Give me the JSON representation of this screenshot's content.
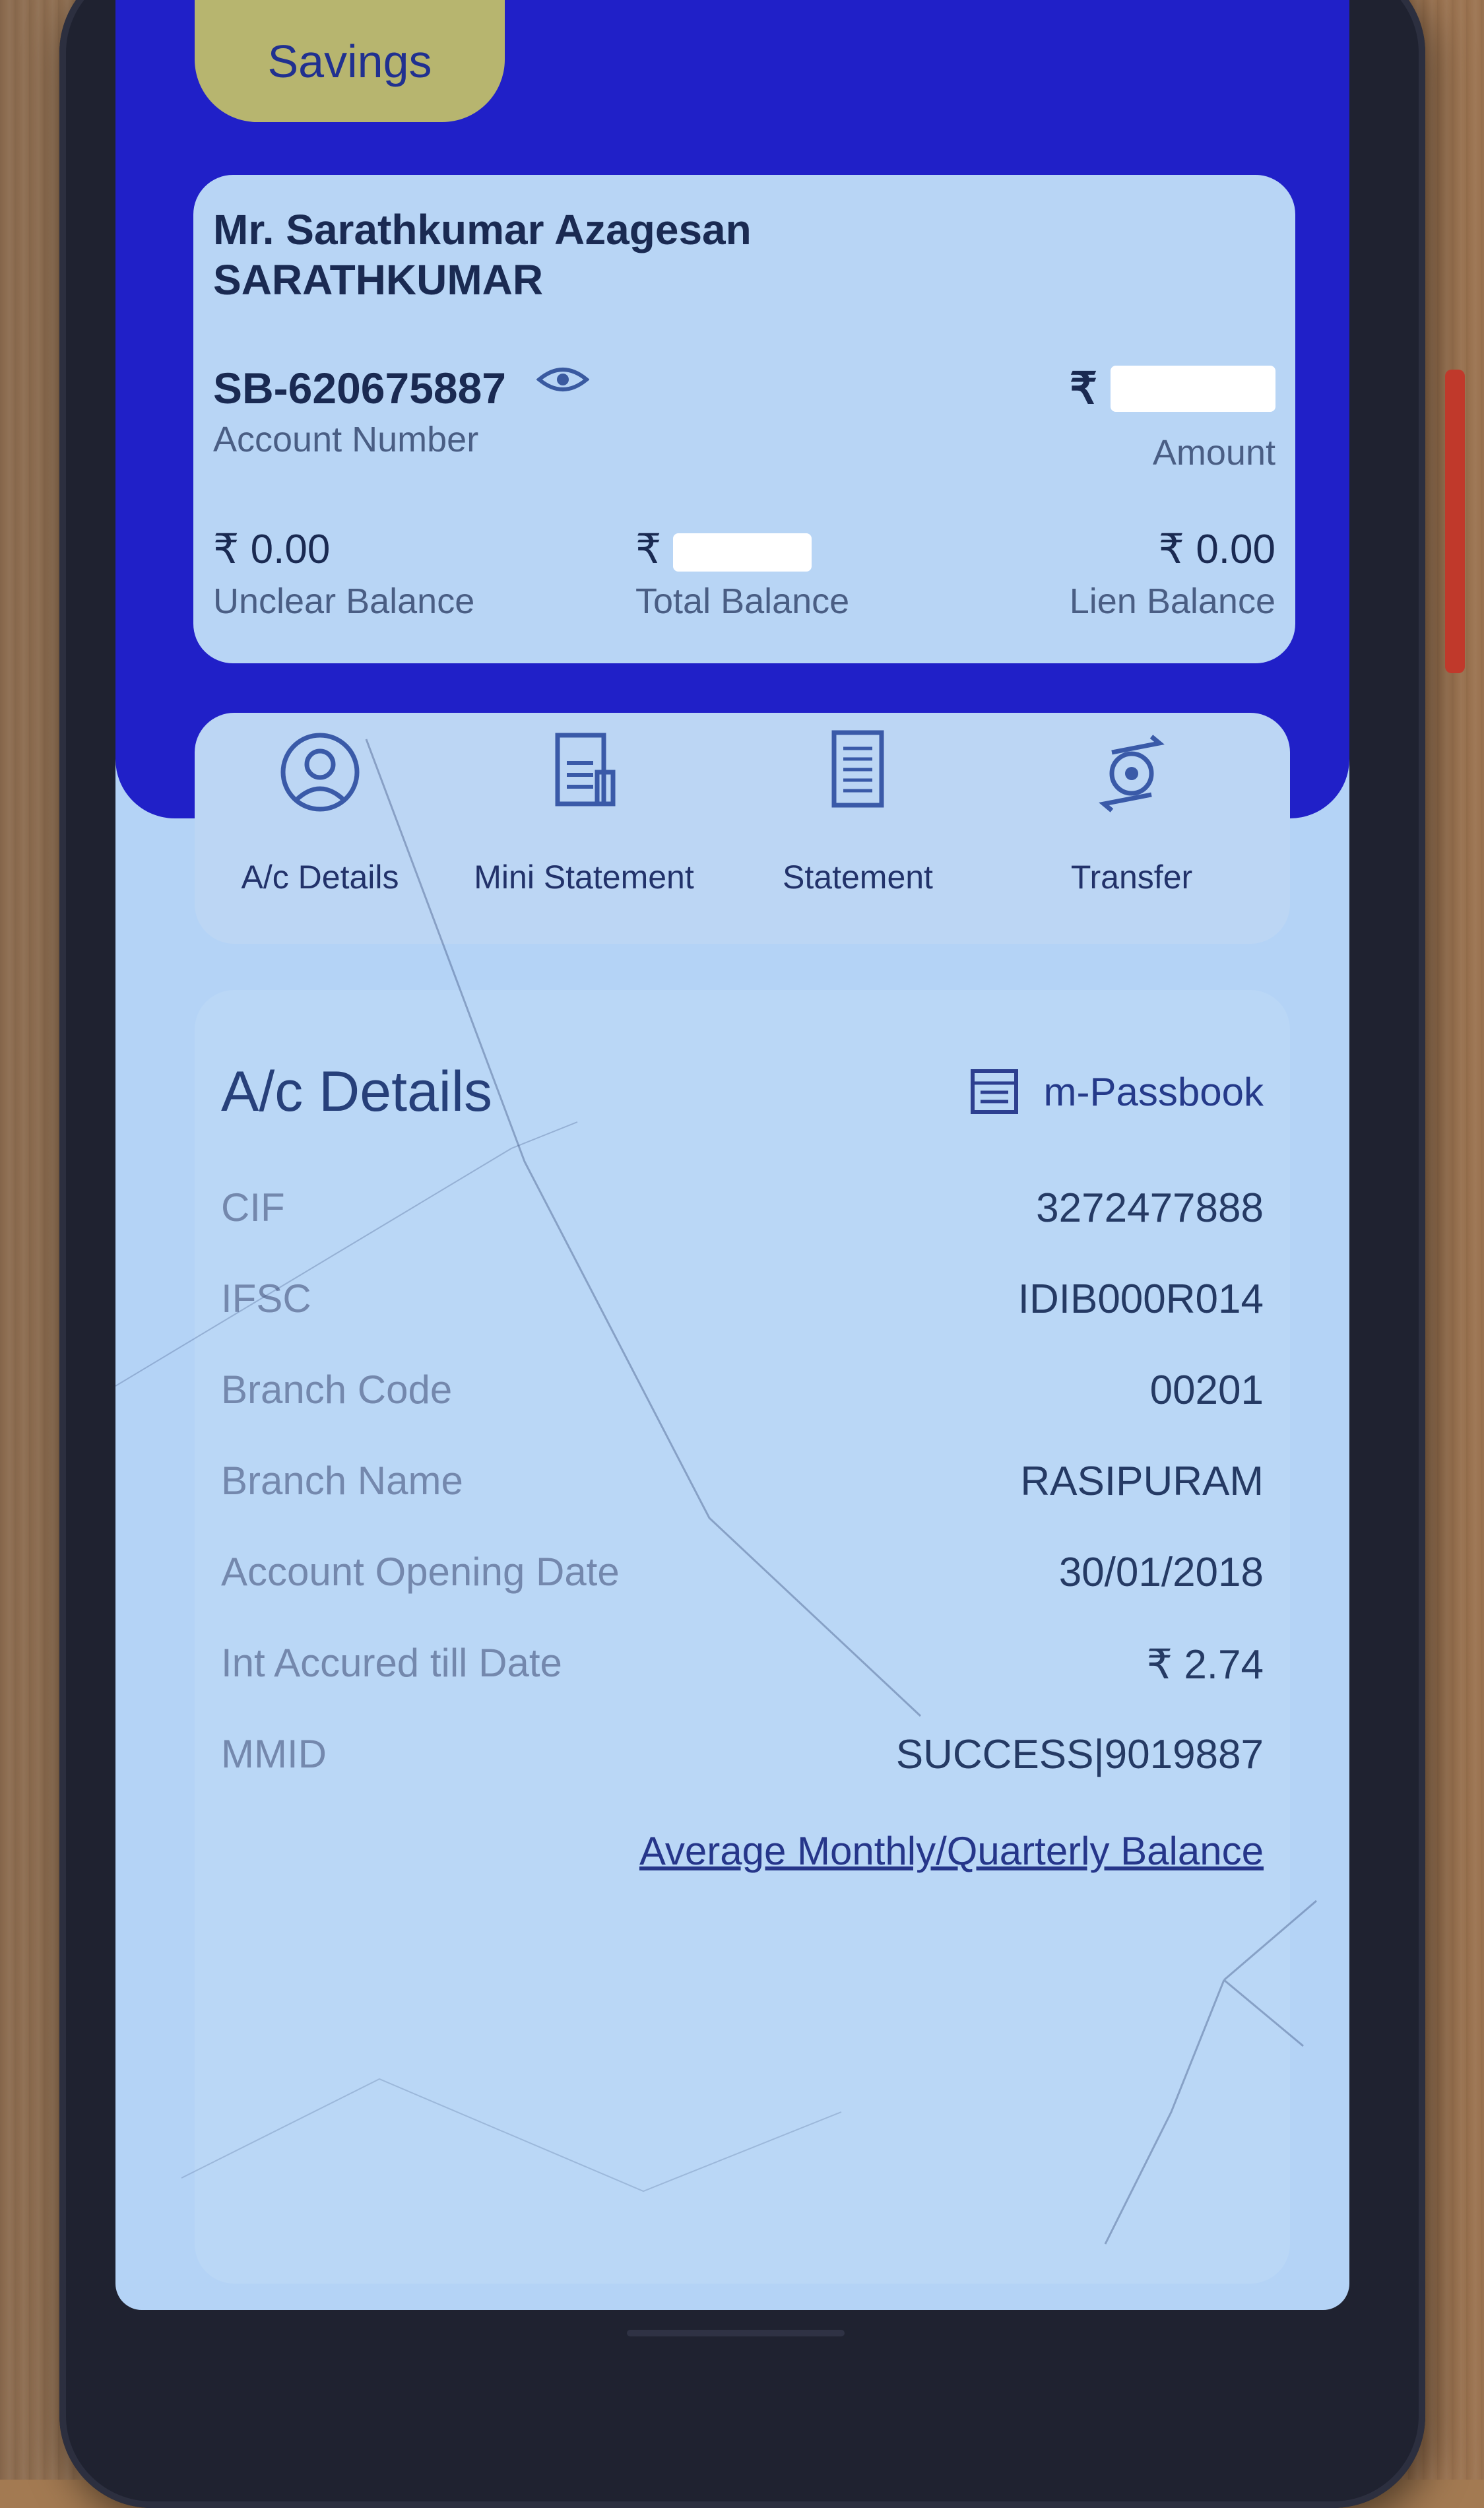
{
  "header": {
    "tab_label": "Savings"
  },
  "account": {
    "holder_name": "Mr. Sarathkumar Azagesan SARATHKUMAR",
    "account_number": "SB-620675887",
    "account_number_label": "Account Number",
    "amount_currency": "₹",
    "amount_label": "Amount",
    "unclear_balance": "₹ 0.00",
    "unclear_balance_label": "Unclear Balance",
    "total_balance_currency": "₹",
    "total_balance_label": "Total Balance",
    "lien_balance": "₹ 0.00",
    "lien_balance_label": "Lien Balance"
  },
  "actions": [
    {
      "label": "A/c Details",
      "icon": "user-circle-icon"
    },
    {
      "label": "Mini Statement",
      "icon": "receipt-icon"
    },
    {
      "label": "Statement",
      "icon": "document-icon"
    },
    {
      "label": "Transfer",
      "icon": "transfer-icon"
    }
  ],
  "details": {
    "title": "A/c Details",
    "passbook_label": "m-Passbook",
    "rows": [
      {
        "label": "CIF",
        "value": "3272477888"
      },
      {
        "label": "IFSC",
        "value": "IDIB000R014"
      },
      {
        "label": "Branch Code",
        "value": "00201"
      },
      {
        "label": "Branch Name",
        "value": "RASIPURAM"
      },
      {
        "label": "Account Opening Date",
        "value": "30/01/2018"
      },
      {
        "label": "Int Accured till Date",
        "value": "₹ 2.74"
      },
      {
        "label": "MMID",
        "value": "SUCCESS|9019887"
      }
    ],
    "avg_balance_link": "Average Monthly/Quarterly Balance"
  },
  "colors": {
    "header_blue": "#2020c8",
    "card_bg": "#b8d5f5",
    "savings_pill": "#b7b56f"
  }
}
